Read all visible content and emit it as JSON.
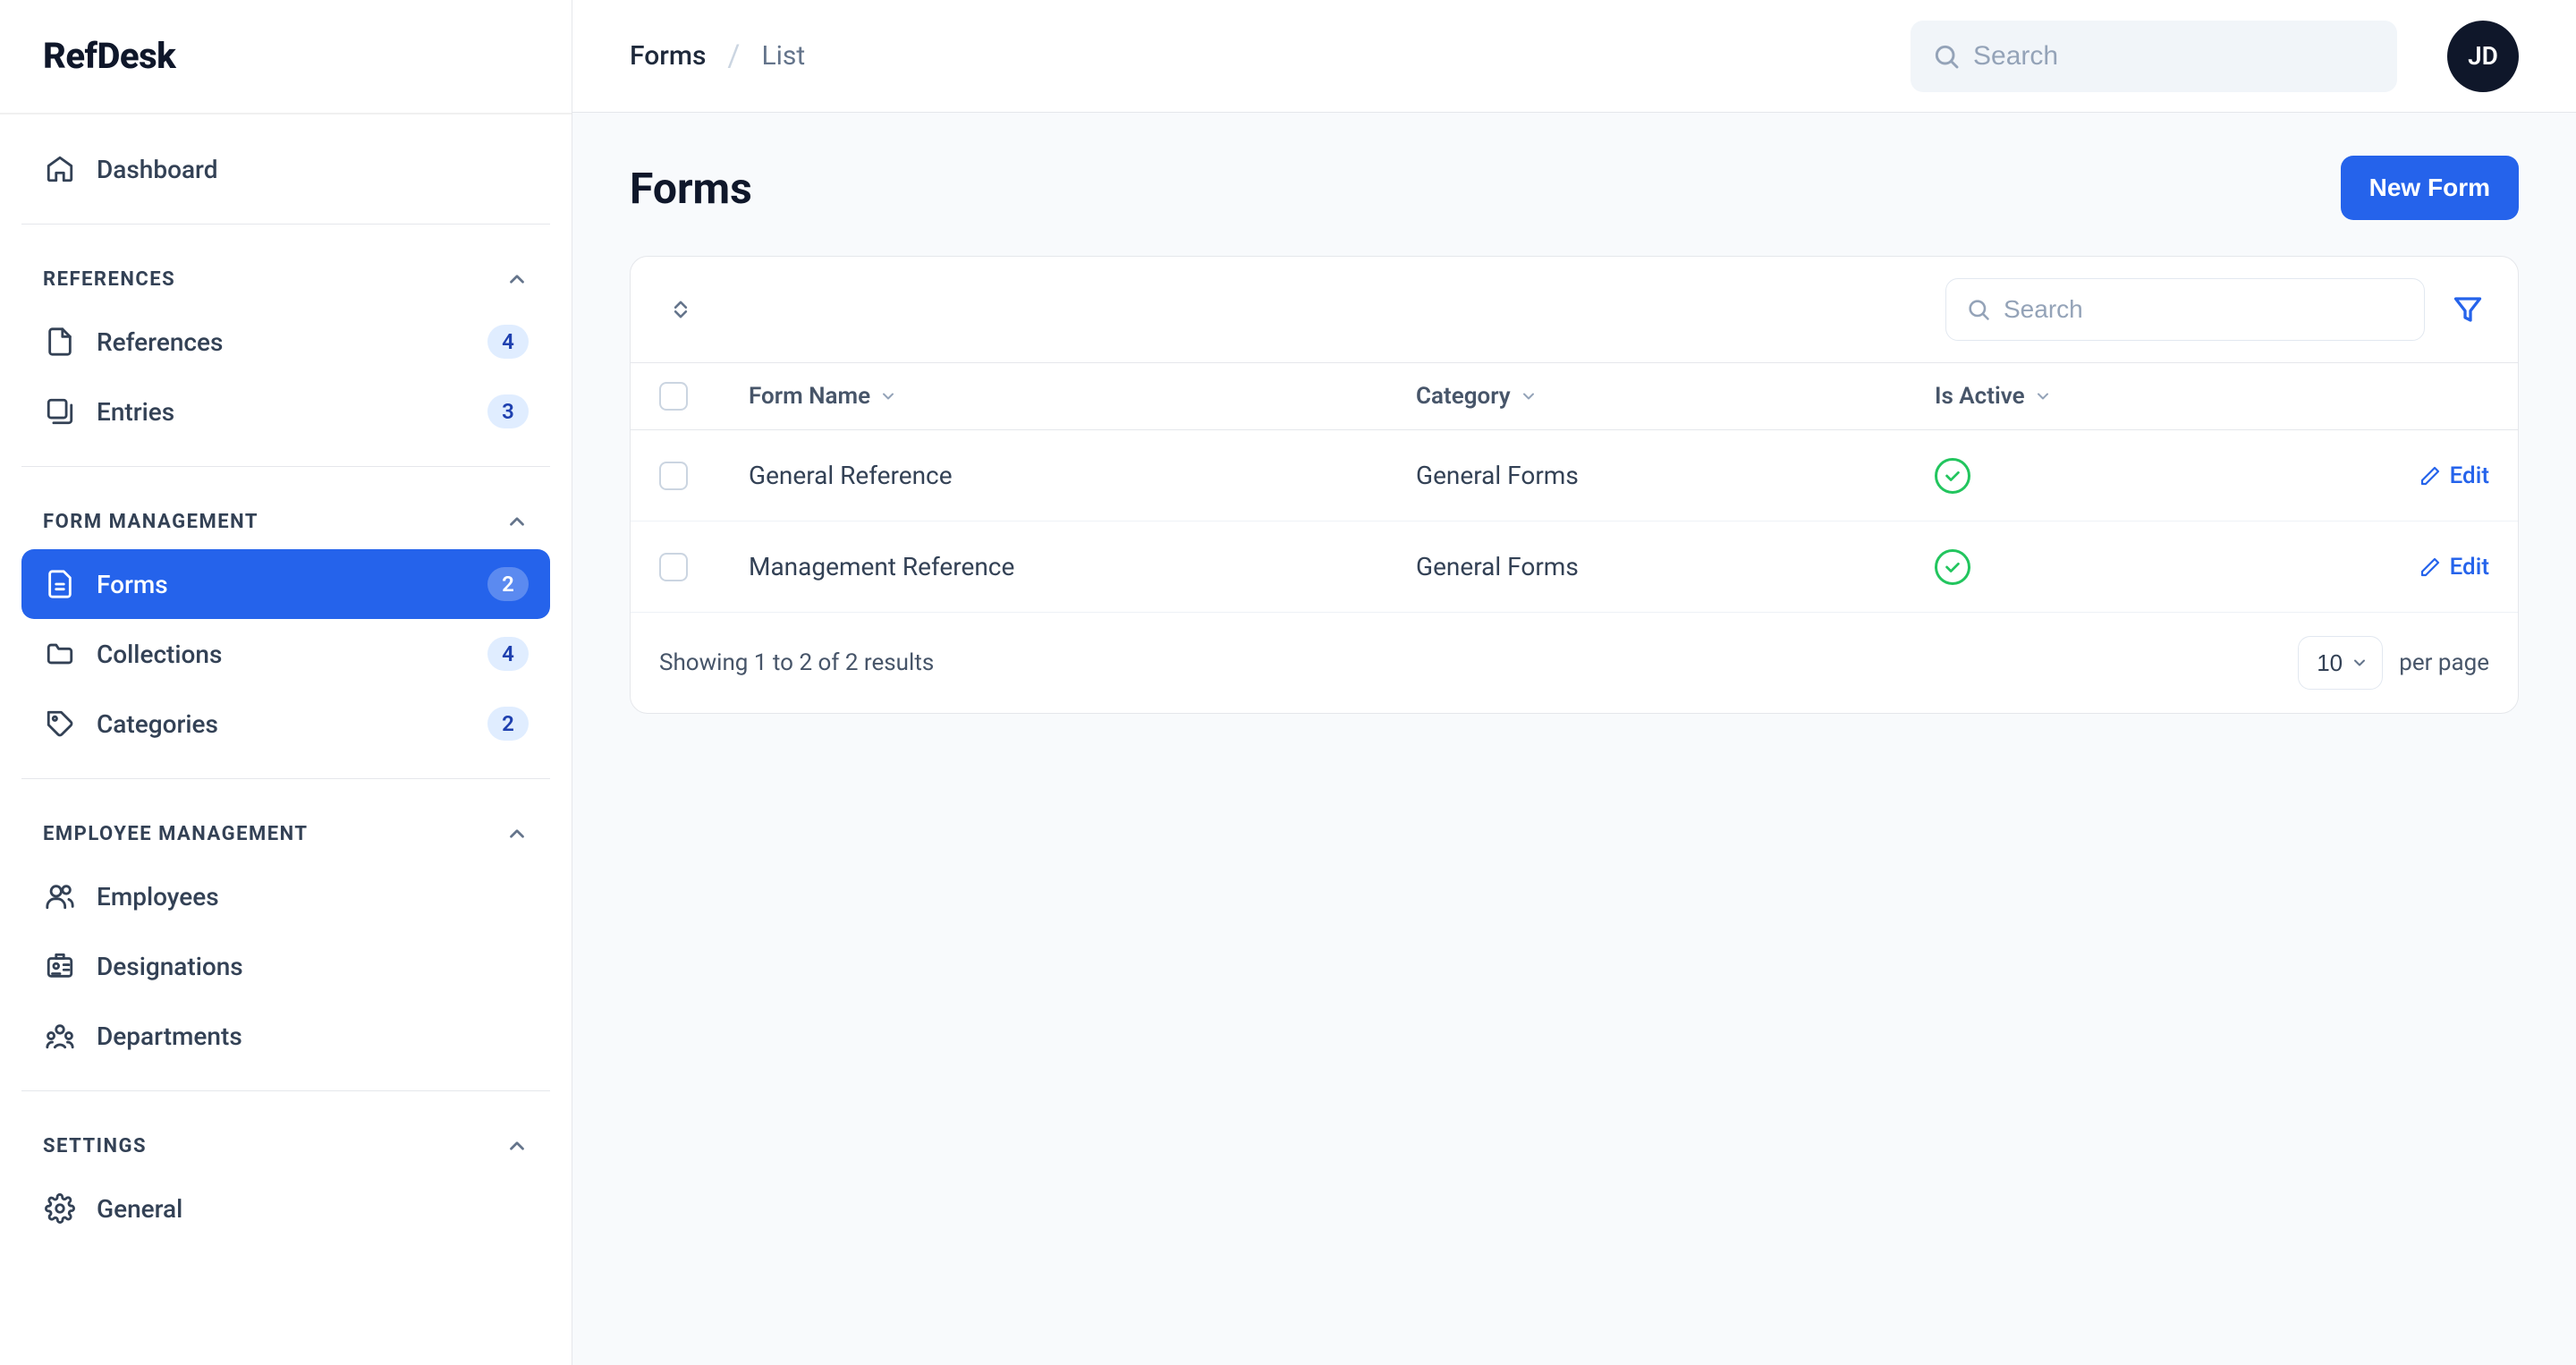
{
  "brand": "RefDesk",
  "breadcrumbs": {
    "root": "Forms",
    "current": "List"
  },
  "topbar": {
    "search_placeholder": "Search",
    "avatar_initials": "JD"
  },
  "sidebar": {
    "dashboard": "Dashboard",
    "sections": {
      "references": {
        "label": "REFERENCES",
        "items": [
          {
            "label": "References",
            "badge": "4"
          },
          {
            "label": "Entries",
            "badge": "3"
          }
        ]
      },
      "form_management": {
        "label": "FORM MANAGEMENT",
        "items": [
          {
            "label": "Forms",
            "badge": "2"
          },
          {
            "label": "Collections",
            "badge": "4"
          },
          {
            "label": "Categories",
            "badge": "2"
          }
        ]
      },
      "employee_management": {
        "label": "EMPLOYEE MANAGEMENT",
        "items": [
          {
            "label": "Employees"
          },
          {
            "label": "Designations"
          },
          {
            "label": "Departments"
          }
        ]
      },
      "settings": {
        "label": "SETTINGS",
        "items": [
          {
            "label": "General"
          }
        ]
      }
    }
  },
  "page": {
    "title": "Forms",
    "new_button": "New Form",
    "table": {
      "search_placeholder": "Search",
      "columns": {
        "form_name": "Form Name",
        "category": "Category",
        "is_active": "Is Active"
      },
      "rows": [
        {
          "name": "General Reference",
          "category": "General Forms",
          "active": true,
          "edit": "Edit"
        },
        {
          "name": "Management Reference",
          "category": "General Forms",
          "active": true,
          "edit": "Edit"
        }
      ],
      "footer": {
        "results_text": "Showing 1 to 2 of 2 results",
        "page_size_selected": "10",
        "page_size_label": "per page"
      }
    }
  }
}
